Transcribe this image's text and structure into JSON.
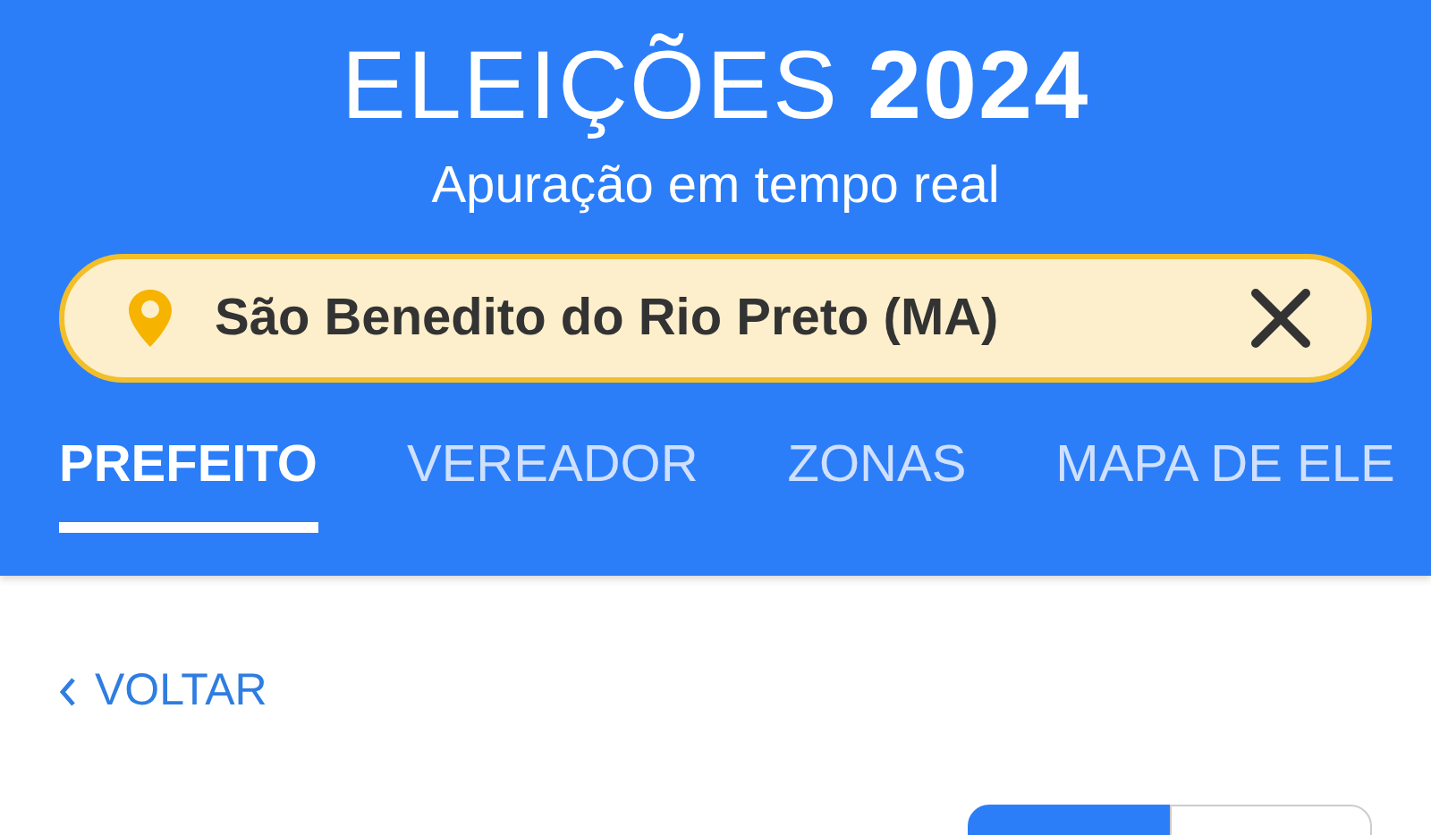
{
  "header": {
    "title": "ELEIÇÕES **2024**",
    "subtitle": "Apuração em tempo real"
  },
  "location": {
    "value": "São Benedito do Rio Preto (MA)"
  },
  "tabs": [
    {
      "label": "PREFEITO",
      "selected": true
    },
    {
      "label": "VEREADOR",
      "selected": false
    },
    {
      "label": "ZONAS",
      "selected": false
    },
    {
      "label": "MAPA DE ELE",
      "selected": false
    }
  ],
  "back_link": {
    "label": "VOLTAR"
  },
  "rounds": [
    {
      "selected": true
    },
    {
      "selected": false
    }
  ]
}
